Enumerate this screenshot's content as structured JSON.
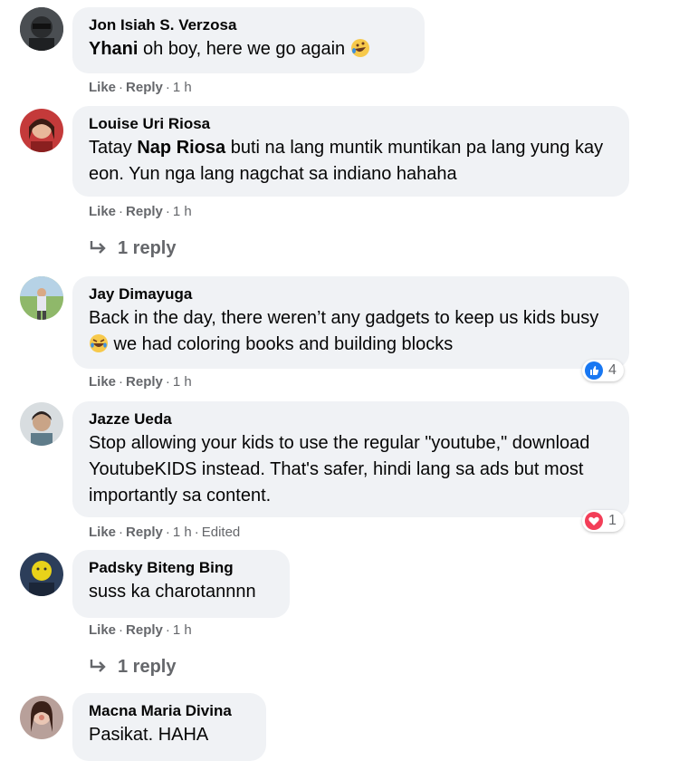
{
  "comments": [
    {
      "author": "Jon Isiah S. Verzosa",
      "mention": "Yhani",
      "text": " oh boy, here we go again ",
      "emoji": "rofl-emoji",
      "like": "Like",
      "reply": "Reply",
      "time": "1 h"
    },
    {
      "author": "Louise Uri Riosa",
      "prefix": "Tatay ",
      "mention": "Nap Riosa",
      "text": " buti na lang muntik muntikan pa lang yung kay eon. Yun nga lang nagchat sa indiano hahaha",
      "like": "Like",
      "reply": "Reply",
      "time": "1 h",
      "replies": "1 reply"
    },
    {
      "author": "Jay Dimayuga",
      "text1": "Back in the day, there weren’t any gadgets to keep us kids busy ",
      "emoji": "laughing-emoji",
      "text2": " we had coloring books and building blocks",
      "like": "Like",
      "reply": "Reply",
      "time": "1 h",
      "reaction_icon": "like-reaction-icon",
      "reaction_count": "4"
    },
    {
      "author": "Jazze Ueda",
      "text": "Stop allowing your kids to use the regular \"youtube,\" download YoutubeKIDS instead. That's safer, hindi lang sa ads but most importantly sa content.",
      "like": "Like",
      "reply": "Reply",
      "time": "1 h",
      "edited": "Edited",
      "reaction_icon": "love-reaction-icon",
      "reaction_count": "1"
    },
    {
      "author": "Padsky Biteng Bing",
      "text": "suss ka charotannnn",
      "like": "Like",
      "reply": "Reply",
      "time": "1 h",
      "replies": "1 reply"
    },
    {
      "author": "Macna Maria Divina",
      "text": "Pasikat. HAHA"
    }
  ],
  "colors": {
    "bubble": "#f0f2f5",
    "meta": "#65676b",
    "like_blue": "#1877f2",
    "love_red": "#f33e58"
  }
}
